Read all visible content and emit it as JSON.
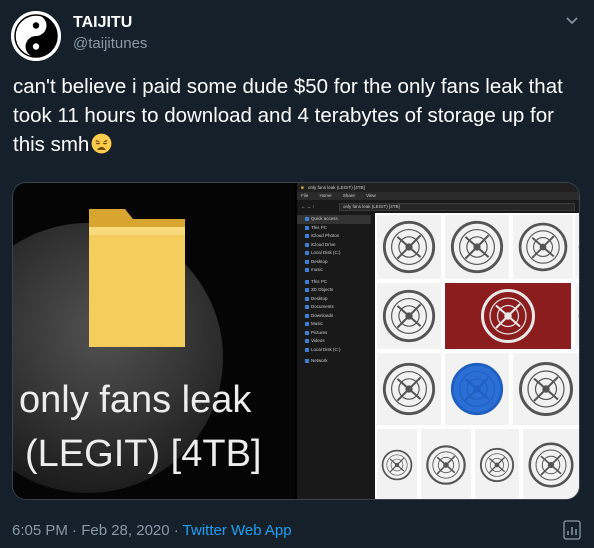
{
  "tweet": {
    "display_name": "TAIJITU",
    "handle": "@taijitunes",
    "text": "can't believe i paid some dude $50 for the only fans leak that took 11 hours to download and 4 terabytes of storage up for this smh",
    "emoji": "weary-face-icon",
    "timestamp": "6:05 PM · Feb 28, 2020 · ",
    "source": "Twitter Web App"
  },
  "media": {
    "folder_caption_line1": "only fans leak",
    "folder_caption_line2": "(LEGIT) [4TB]",
    "explorer": {
      "window_title": "only fans leak (LEGIT) [4TB]",
      "ribbon_tabs": [
        "File",
        "Home",
        "Share",
        "View"
      ],
      "address": "only fans leak (LEGIT) [4TB]",
      "nav_items": [
        "Quick access",
        "This PC",
        "iCloud Photos",
        "iCloud Drive",
        "Local Disk (C:)",
        "Desktop",
        "music",
        "This PC",
        "3D Objects",
        "Desktop",
        "Documents",
        "Downloads",
        "Music",
        "Pictures",
        "Videos",
        "Local Disk (C:)",
        "Network"
      ]
    }
  },
  "colors": {
    "background": "#15202b",
    "secondary_text": "#8899a6",
    "link": "#1da1f2",
    "folder": "#f2c94c"
  }
}
